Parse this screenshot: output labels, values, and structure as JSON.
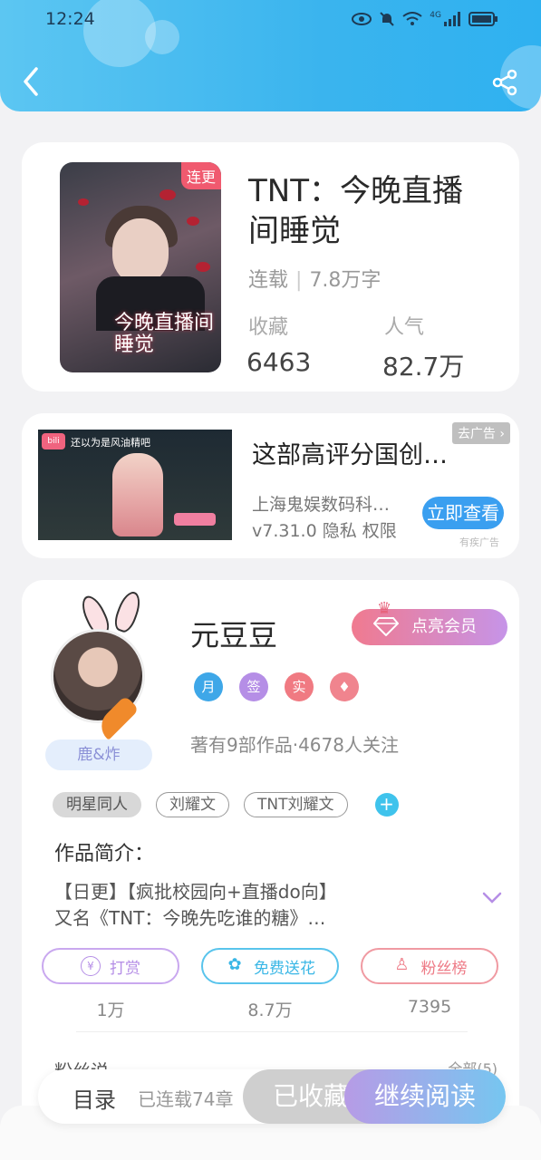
{
  "status_bar": {
    "time": "12:24",
    "network": "4G"
  },
  "colors": {
    "header": "#3ab4ee",
    "accent_blue": "#3fc3ec",
    "vip_pink": "#f07a8f",
    "continue_gradient": "#b79be6"
  },
  "book": {
    "serial_tag": "连更",
    "cover_title": "今晚直播间睡觉",
    "title": "TNT：今晚直播间睡觉",
    "status": "连载",
    "word_count": "7.8万字",
    "favorites_label": "收藏",
    "favorites_value": "6463",
    "popularity_label": "人气",
    "popularity_value": "82.7万"
  },
  "ad": {
    "image_caption": "还以为是风油精吧",
    "title": "这部高评分国创…",
    "close_label": "去广告",
    "advertiser": "上海鬼娱数码科…",
    "version_line": "v7.31.0 隐私 权限",
    "cta": "立即查看",
    "ad_mark": "有疾广告"
  },
  "author": {
    "badge_nickname": "鹿&炸",
    "name": "元豆豆",
    "vip_button": "点亮会员",
    "badges": [
      "月",
      "签",
      "实",
      "♦"
    ],
    "stats": "著有9部作品·4678人关注",
    "tags": [
      "明星同人",
      "刘耀文",
      "TNT刘耀文"
    ],
    "tag_add": "+",
    "intro_label": "作品简介：",
    "intro_line1": "【日更】【疯批校园向+直播do向】",
    "intro_line2": "又名《TNT：今晚先吃谁的糖》…",
    "actions": [
      {
        "label": "打赏",
        "icon": "¥",
        "count": "1万"
      },
      {
        "label": "免费送花",
        "icon": "✿",
        "count": "8.7万"
      },
      {
        "label": "粉丝榜",
        "icon": "♙",
        "count": "7395"
      }
    ],
    "fans_partial": "粉丝说",
    "all_partial": "全部(5)"
  },
  "bottom_bar": {
    "toc": "目录",
    "toc_count": "已连载74章",
    "collected": "已收藏",
    "continue": "继续阅读"
  }
}
